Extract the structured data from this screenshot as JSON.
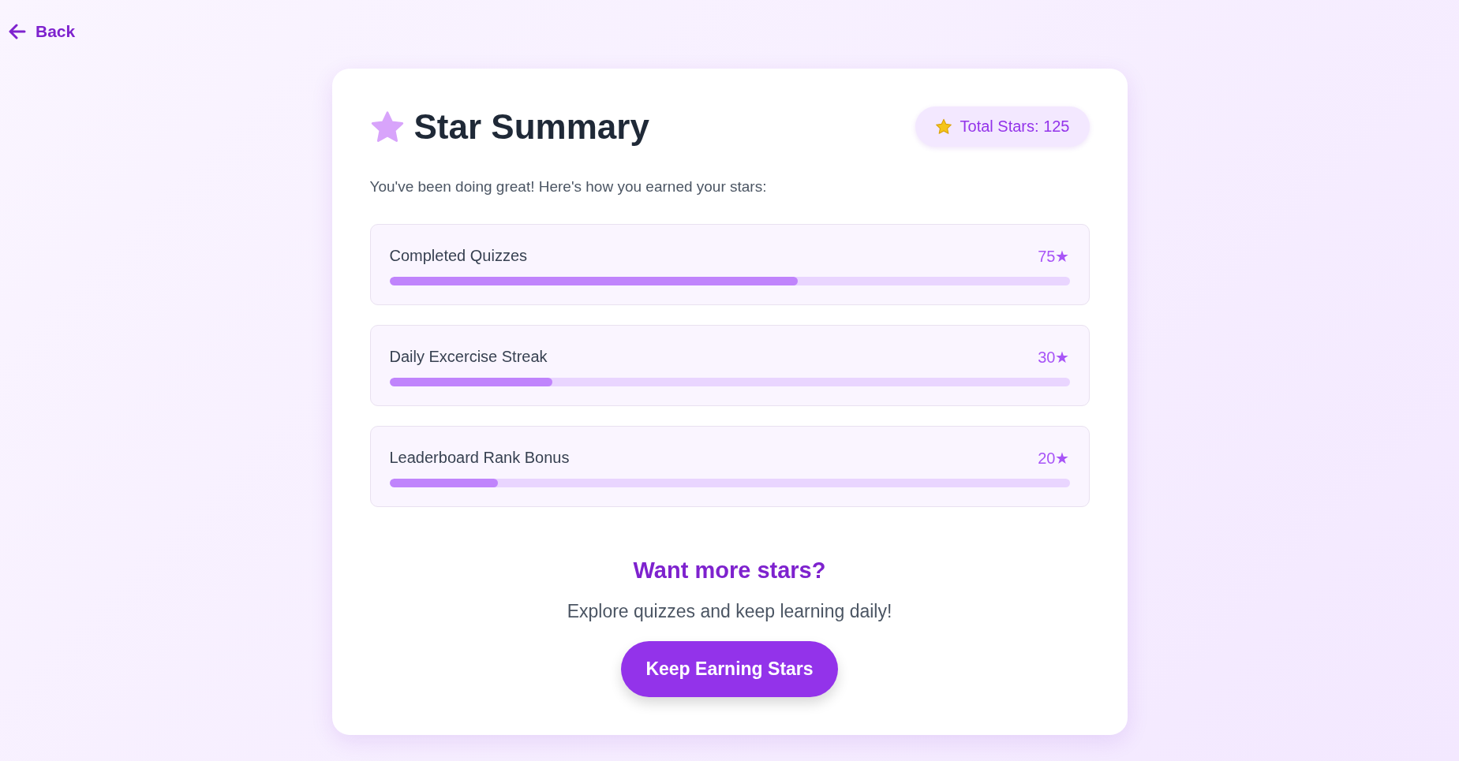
{
  "back_link": {
    "label": "Back"
  },
  "header": {
    "title": "Star Summary",
    "total_badge": "Total Stars: 125"
  },
  "intro": "You've been doing great! Here's how you earned your stars:",
  "categories": [
    {
      "label": "Completed Quizzes",
      "value": "75★",
      "level": 0.6
    },
    {
      "label": "Daily Excercise Streak",
      "value": "30★",
      "level": 0.24
    },
    {
      "label": "Leaderboard Rank Bonus",
      "value": "20★",
      "level": 0.16
    }
  ],
  "cta": {
    "heading": "Want more stars?",
    "text": "Explore quizzes and keep learning daily!",
    "button": "Keep Earning Stars"
  }
}
